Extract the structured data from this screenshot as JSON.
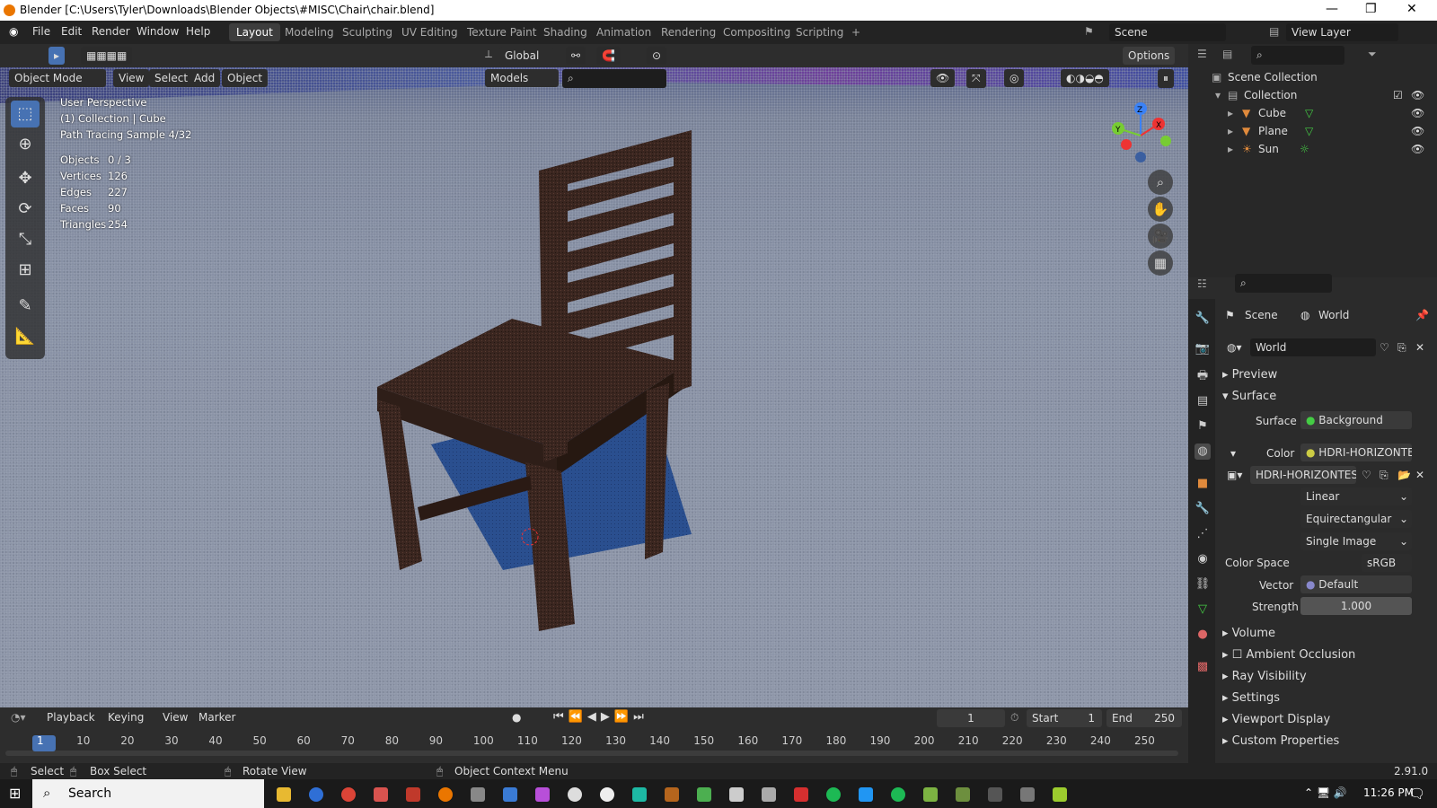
{
  "window": {
    "title": "Blender [C:\\Users\\Tyler\\Downloads\\Blender Objects\\#MISC\\Chair\\chair.blend]",
    "min": "—",
    "max": "❐",
    "close": "✕"
  },
  "menu": {
    "items": [
      "File",
      "Edit",
      "Render",
      "Window",
      "Help"
    ],
    "workspaces": [
      "Layout",
      "Modeling",
      "Sculpting",
      "UV Editing",
      "Texture Paint",
      "Shading",
      "Animation",
      "Rendering",
      "Compositing",
      "Scripting"
    ],
    "add_tab": "+",
    "scene": "Scene",
    "view_layer": "View Layer"
  },
  "header": {
    "orientation": "Global",
    "options": "Options",
    "mode": "Object Mode",
    "view": "View",
    "select": "Select",
    "add": "Add",
    "object": "Object",
    "collection_filter": "Models"
  },
  "overlay": {
    "perspective": "User Perspective",
    "context": "(1) Collection | Cube",
    "sample": "Path Tracing Sample 4/32",
    "stats": [
      {
        "k": "Objects",
        "v": "0 / 3"
      },
      {
        "k": "Vertices",
        "v": "126"
      },
      {
        "k": "Edges",
        "v": "227"
      },
      {
        "k": "Faces",
        "v": "90"
      },
      {
        "k": "Triangles",
        "v": "254"
      }
    ]
  },
  "gizmo": {
    "x": "X",
    "y": "Y",
    "z": "Z"
  },
  "outliner": {
    "root": "Scene Collection",
    "collection": "Collection",
    "objects": [
      "Cube",
      "Plane",
      "Sun"
    ]
  },
  "props": {
    "scene": "Scene",
    "world": "World",
    "world_name": "World",
    "sections": {
      "preview": "Preview",
      "surface": "Surface",
      "volume": "Volume",
      "ao": "Ambient Occlusion",
      "ray": "Ray Visibility",
      "settings": "Settings",
      "viewport": "Viewport Display",
      "custom": "Custom Properties"
    },
    "surface_label": "Surface",
    "surface_value": "Background",
    "color_label": "Color",
    "color_value": "HDRI-HORIZONTES-...",
    "image_name": "HDRI-HORIZONTES-...",
    "interp": "Linear",
    "proj": "Equirectangular",
    "source": "Single Image",
    "colorspace_label": "Color Space",
    "colorspace_value": "sRGB",
    "vector_label": "Vector",
    "vector_value": "Default",
    "strength_label": "Strength",
    "strength_value": "1.000"
  },
  "timeline": {
    "playback": "Playback",
    "keying": "Keying",
    "view": "View",
    "marker": "Marker",
    "current": "1",
    "start_label": "Start",
    "start": "1",
    "end_label": "End",
    "end": "250",
    "ticks": [
      "1",
      "10",
      "20",
      "30",
      "40",
      "50",
      "60",
      "70",
      "80",
      "90",
      "100",
      "110",
      "120",
      "130",
      "140",
      "150",
      "160",
      "170",
      "180",
      "190",
      "200",
      "210",
      "220",
      "230",
      "240",
      "250"
    ]
  },
  "status": {
    "select": "Select",
    "box_select": "Box Select",
    "rotate": "Rotate View",
    "context_menu": "Object Context Menu",
    "version": "2.91.0"
  },
  "taskbar": {
    "search": "Search",
    "time": "11:26 PM"
  }
}
